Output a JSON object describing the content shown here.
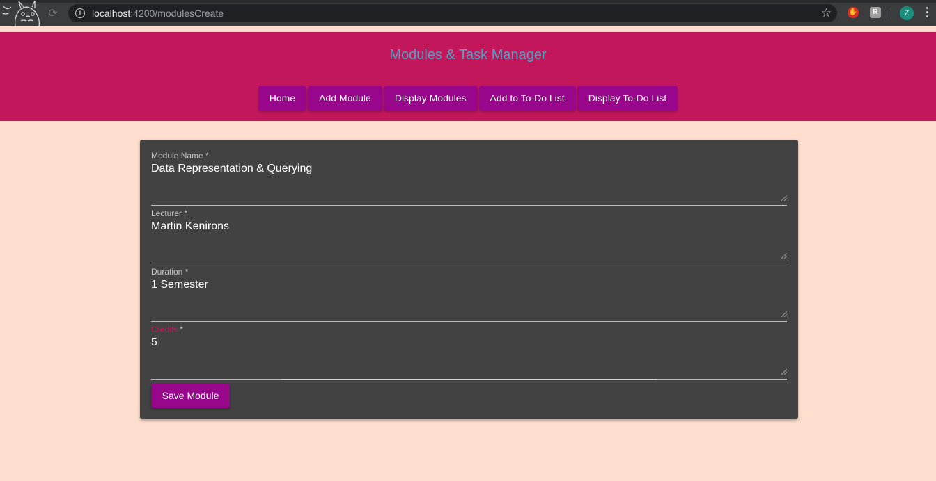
{
  "browser": {
    "url_host": "localhost",
    "url_rest": ":4200/modulesCreate",
    "ext_r_label": "R",
    "avatar_letter": "Z"
  },
  "app": {
    "title": "Modules & Task Manager",
    "nav": [
      {
        "label": "Home"
      },
      {
        "label": "Add Module"
      },
      {
        "label": "Display Modules"
      },
      {
        "label": "Add to To-Do List"
      },
      {
        "label": "Display To-Do List"
      }
    ]
  },
  "form": {
    "fields": [
      {
        "label": "Module Name",
        "required": "*",
        "value": "Data Representation & Querying"
      },
      {
        "label": "Lecturer",
        "required": "*",
        "value": "Martin Kenirons"
      },
      {
        "label": "Duration",
        "required": "*",
        "value": "1 Semester"
      },
      {
        "label": "Credits",
        "required": "*",
        "value": "5"
      }
    ],
    "submit_label": "Save Module"
  },
  "colors": {
    "header": "#c2185b",
    "button": "#98068c",
    "background": "#ffdecf",
    "card": "#424242",
    "title": "#4fa3c4"
  }
}
